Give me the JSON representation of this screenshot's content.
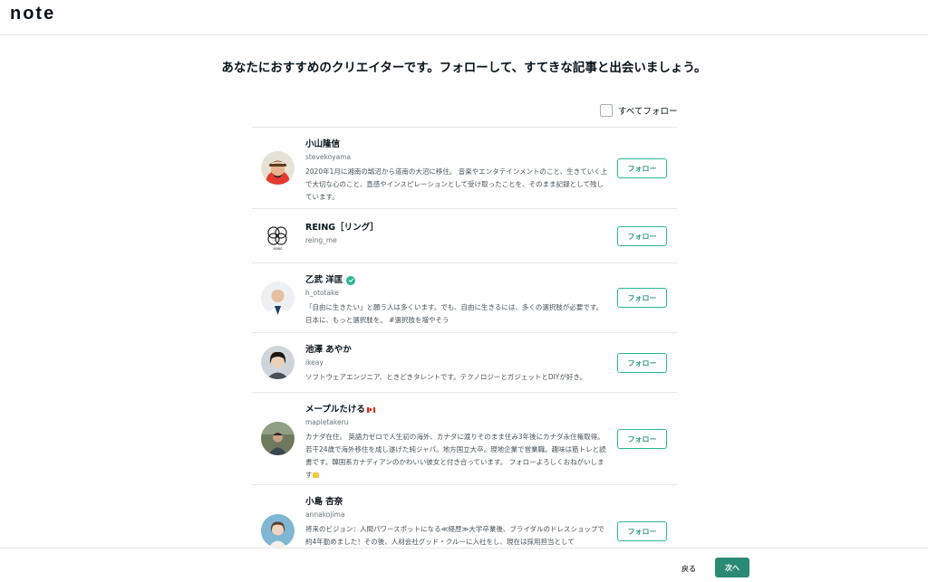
{
  "brand": {
    "logo_text": "note"
  },
  "page": {
    "heading": "あなたにおすすめのクリエイターです。フォローして、すてきな記事と出会いましょう。"
  },
  "follow_all": {
    "label": "すべてフォロー",
    "checked": false
  },
  "creators": [
    {
      "name": "小山隆信",
      "id": "stevekoyama",
      "bio": "2020年1月に湘南の鵠沼から道南の大沼に移住。 音楽やエンタテインメントのこと、生きていく上で大切な心のこと、直感やインスピレーションとして受け取ったことを、そのまま記録として残しています。",
      "button": "フォロー"
    },
    {
      "name": "REING［リング］",
      "id": "reing_me",
      "bio": "",
      "button": "フォロー",
      "logo_caption": "REING"
    },
    {
      "name": "乙武 洋匡",
      "id": "h_ototake",
      "bio": "「自由に生きたい」と願う人は多くいます。でも、自由に生きるには、多くの選択肢が必要です。日本に、もっと選択肢を。 #選択肢を増やそう",
      "button": "フォロー",
      "verified": true
    },
    {
      "name": "池澤 あやか",
      "id": "ikeay",
      "bio": "ソフトウェアエンジニア、ときどきタレントです。テクノロジーとガジェットとDIYが好き。",
      "button": "フォロー"
    },
    {
      "name": "メープルたける",
      "id": "mapletakeru",
      "bio": "カナダ在住。 英語力ゼロで人生初の海外、カナダに渡りそのまま住み3年後にカナダ永住権取得。若干24歳で海外移住を成し遂げた純ジャパ。地方国立大卒。現地企業で営業職。趣味は筋トレと読書です。韓国系カナディアンのかわいい彼女と付き合っています。 フォローよろしくおねがいします",
      "button": "フォロー",
      "flag": "canada-flag-icon"
    },
    {
      "name": "小島 杏奈",
      "id": "annakojima",
      "bio": "将来のビジョン：人間パワースポットになる≪経歴≫大学卒業後、ブライダルのドレスショップで約4年勤めました！その後、人材会社グッド・クルーに入社をし、現在は採用担当として",
      "button": "フォロー"
    }
  ],
  "footer": {
    "back_label": "戻る",
    "next_label": "次へ"
  },
  "colors": {
    "accent": "#2cb696",
    "next_button": "#2b8a74",
    "text": "#08131a",
    "divider": "#e6e6e6"
  }
}
